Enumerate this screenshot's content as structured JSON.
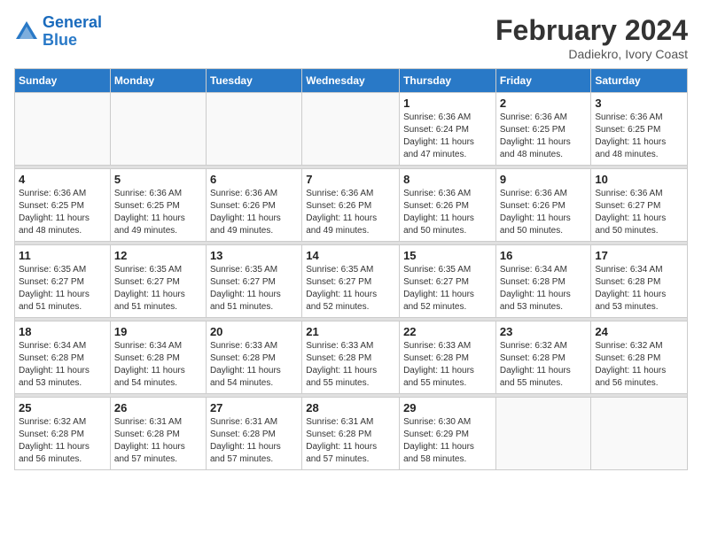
{
  "logo": {
    "text_general": "General",
    "text_blue": "Blue"
  },
  "header": {
    "month_year": "February 2024",
    "location": "Dadiekro, Ivory Coast"
  },
  "weekdays": [
    "Sunday",
    "Monday",
    "Tuesday",
    "Wednesday",
    "Thursday",
    "Friday",
    "Saturday"
  ],
  "weeks": [
    [
      {
        "day": "",
        "info": ""
      },
      {
        "day": "",
        "info": ""
      },
      {
        "day": "",
        "info": ""
      },
      {
        "day": "",
        "info": ""
      },
      {
        "day": "1",
        "info": "Sunrise: 6:36 AM\nSunset: 6:24 PM\nDaylight: 11 hours\nand 47 minutes."
      },
      {
        "day": "2",
        "info": "Sunrise: 6:36 AM\nSunset: 6:25 PM\nDaylight: 11 hours\nand 48 minutes."
      },
      {
        "day": "3",
        "info": "Sunrise: 6:36 AM\nSunset: 6:25 PM\nDaylight: 11 hours\nand 48 minutes."
      }
    ],
    [
      {
        "day": "4",
        "info": "Sunrise: 6:36 AM\nSunset: 6:25 PM\nDaylight: 11 hours\nand 48 minutes."
      },
      {
        "day": "5",
        "info": "Sunrise: 6:36 AM\nSunset: 6:25 PM\nDaylight: 11 hours\nand 49 minutes."
      },
      {
        "day": "6",
        "info": "Sunrise: 6:36 AM\nSunset: 6:26 PM\nDaylight: 11 hours\nand 49 minutes."
      },
      {
        "day": "7",
        "info": "Sunrise: 6:36 AM\nSunset: 6:26 PM\nDaylight: 11 hours\nand 49 minutes."
      },
      {
        "day": "8",
        "info": "Sunrise: 6:36 AM\nSunset: 6:26 PM\nDaylight: 11 hours\nand 50 minutes."
      },
      {
        "day": "9",
        "info": "Sunrise: 6:36 AM\nSunset: 6:26 PM\nDaylight: 11 hours\nand 50 minutes."
      },
      {
        "day": "10",
        "info": "Sunrise: 6:36 AM\nSunset: 6:27 PM\nDaylight: 11 hours\nand 50 minutes."
      }
    ],
    [
      {
        "day": "11",
        "info": "Sunrise: 6:35 AM\nSunset: 6:27 PM\nDaylight: 11 hours\nand 51 minutes."
      },
      {
        "day": "12",
        "info": "Sunrise: 6:35 AM\nSunset: 6:27 PM\nDaylight: 11 hours\nand 51 minutes."
      },
      {
        "day": "13",
        "info": "Sunrise: 6:35 AM\nSunset: 6:27 PM\nDaylight: 11 hours\nand 51 minutes."
      },
      {
        "day": "14",
        "info": "Sunrise: 6:35 AM\nSunset: 6:27 PM\nDaylight: 11 hours\nand 52 minutes."
      },
      {
        "day": "15",
        "info": "Sunrise: 6:35 AM\nSunset: 6:27 PM\nDaylight: 11 hours\nand 52 minutes."
      },
      {
        "day": "16",
        "info": "Sunrise: 6:34 AM\nSunset: 6:28 PM\nDaylight: 11 hours\nand 53 minutes."
      },
      {
        "day": "17",
        "info": "Sunrise: 6:34 AM\nSunset: 6:28 PM\nDaylight: 11 hours\nand 53 minutes."
      }
    ],
    [
      {
        "day": "18",
        "info": "Sunrise: 6:34 AM\nSunset: 6:28 PM\nDaylight: 11 hours\nand 53 minutes."
      },
      {
        "day": "19",
        "info": "Sunrise: 6:34 AM\nSunset: 6:28 PM\nDaylight: 11 hours\nand 54 minutes."
      },
      {
        "day": "20",
        "info": "Sunrise: 6:33 AM\nSunset: 6:28 PM\nDaylight: 11 hours\nand 54 minutes."
      },
      {
        "day": "21",
        "info": "Sunrise: 6:33 AM\nSunset: 6:28 PM\nDaylight: 11 hours\nand 55 minutes."
      },
      {
        "day": "22",
        "info": "Sunrise: 6:33 AM\nSunset: 6:28 PM\nDaylight: 11 hours\nand 55 minutes."
      },
      {
        "day": "23",
        "info": "Sunrise: 6:32 AM\nSunset: 6:28 PM\nDaylight: 11 hours\nand 55 minutes."
      },
      {
        "day": "24",
        "info": "Sunrise: 6:32 AM\nSunset: 6:28 PM\nDaylight: 11 hours\nand 56 minutes."
      }
    ],
    [
      {
        "day": "25",
        "info": "Sunrise: 6:32 AM\nSunset: 6:28 PM\nDaylight: 11 hours\nand 56 minutes."
      },
      {
        "day": "26",
        "info": "Sunrise: 6:31 AM\nSunset: 6:28 PM\nDaylight: 11 hours\nand 57 minutes."
      },
      {
        "day": "27",
        "info": "Sunrise: 6:31 AM\nSunset: 6:28 PM\nDaylight: 11 hours\nand 57 minutes."
      },
      {
        "day": "28",
        "info": "Sunrise: 6:31 AM\nSunset: 6:28 PM\nDaylight: 11 hours\nand 57 minutes."
      },
      {
        "day": "29",
        "info": "Sunrise: 6:30 AM\nSunset: 6:29 PM\nDaylight: 11 hours\nand 58 minutes."
      },
      {
        "day": "",
        "info": ""
      },
      {
        "day": "",
        "info": ""
      }
    ]
  ]
}
